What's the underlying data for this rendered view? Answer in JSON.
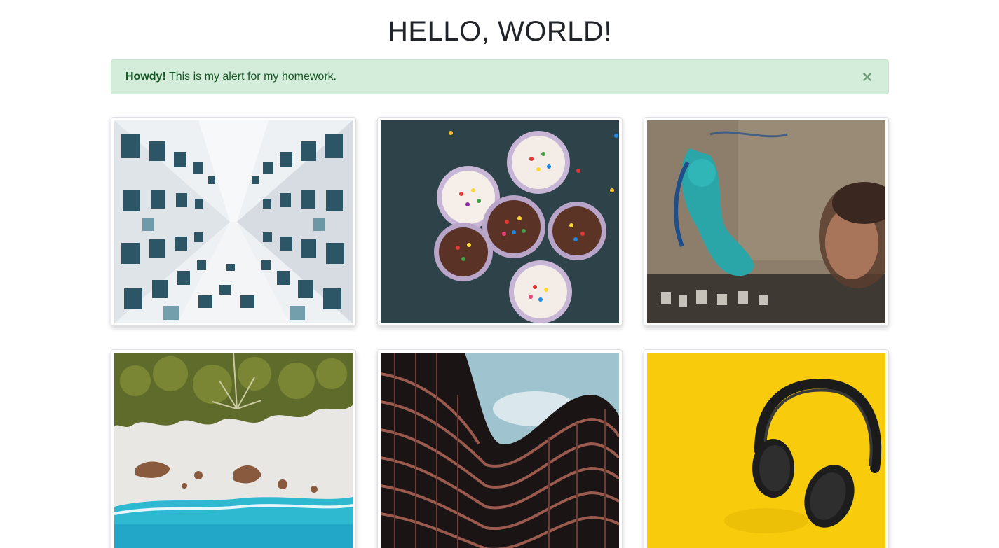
{
  "page": {
    "title": "HELLO, WORLD!"
  },
  "alert": {
    "strong": "Howdy!",
    "message": " This is my alert for my homework.",
    "close_symbol": "×",
    "color": "#155724",
    "background": "#d4edda"
  },
  "gallery": {
    "photos": [
      {
        "name": "architecture-building-photo"
      },
      {
        "name": "cupcakes-photo"
      },
      {
        "name": "street-art-mural-photo"
      },
      {
        "name": "aerial-beach-photo"
      },
      {
        "name": "curved-building-photo"
      },
      {
        "name": "headphones-photo"
      }
    ]
  }
}
